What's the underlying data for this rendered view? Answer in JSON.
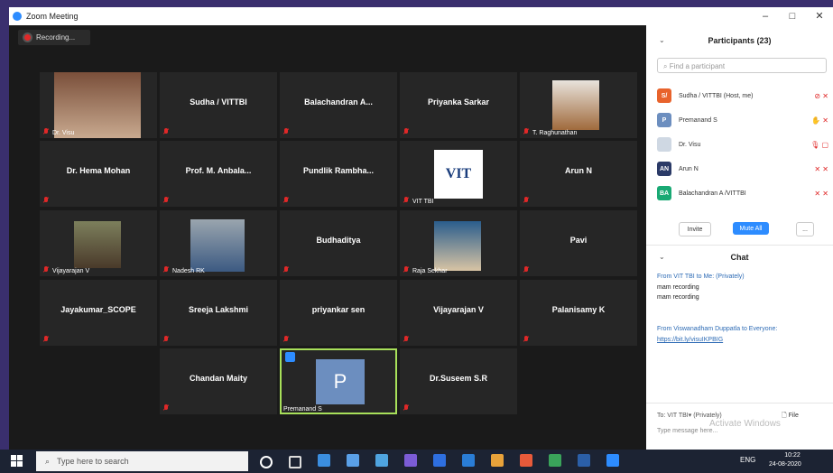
{
  "window": {
    "title": "Zoom Meeting",
    "controls": [
      "–",
      "□",
      "✕"
    ]
  },
  "recording": {
    "label": "Recording..."
  },
  "tiles": [
    {
      "name": "",
      "label": "Dr. Visu"
    },
    {
      "name": "Sudha / VITTBI",
      "label": ""
    },
    {
      "name": "Balachandran A...",
      "label": ""
    },
    {
      "name": "Priyanka Sarkar",
      "label": ""
    },
    {
      "name": "",
      "label": "T. Raghunathan"
    },
    {
      "name": "Dr. Hema Mohan",
      "label": ""
    },
    {
      "name": "Prof. M. Anbala...",
      "label": ""
    },
    {
      "name": "Pundlik Rambha...",
      "label": ""
    },
    {
      "name": "",
      "label": "VIT TBI"
    },
    {
      "name": "Arun N",
      "label": ""
    },
    {
      "name": "",
      "label": "Vijayarajan V"
    },
    {
      "name": "",
      "label": "Nadesh RK"
    },
    {
      "name": "Budhaditya",
      "label": ""
    },
    {
      "name": "",
      "label": "Raja Sekhar"
    },
    {
      "name": "Pavi",
      "label": ""
    },
    {
      "name": "Jayakumar_SCOPE",
      "label": ""
    },
    {
      "name": "Sreeja Lakshmi",
      "label": ""
    },
    {
      "name": "priyankar sen",
      "label": ""
    },
    {
      "name": "Vijayarajan V",
      "label": ""
    },
    {
      "name": "Palanisamy K",
      "label": ""
    },
    {
      "name": "Chandan Maity",
      "label": ""
    },
    {
      "name": "",
      "label": "Premanand S"
    },
    {
      "name": "Dr.Suseem S.R",
      "label": ""
    }
  ],
  "vit_logo": "VIT",
  "avatar_letter": "P",
  "participants": {
    "title": "Participants (23)",
    "search_placeholder": "Find a participant",
    "list": [
      {
        "initials": "S/",
        "name": "Sudha / VITTBI (Host, me)",
        "color": "#e8632c"
      },
      {
        "initials": "P",
        "name": "Premanand S",
        "color": "#6c8ebf"
      },
      {
        "initials": "",
        "name": "Dr. Visu",
        "color": "#cfd8e3"
      },
      {
        "initials": "AN",
        "name": "Arun N",
        "color": "#2b3a67"
      },
      {
        "initials": "BA",
        "name": "Balachandran A /VITTBI",
        "color": "#19a974"
      }
    ],
    "invite": "Invite",
    "mute_all": "Mute All",
    "more": "..."
  },
  "chat": {
    "title": "Chat",
    "msg1_from": "From VIT TBI to Me: (Privately)",
    "msg1_lines": [
      "mam recording",
      "mam recording"
    ],
    "msg2_from": "From Viswanadham Duppatla to Everyone:",
    "msg2_link": "https://bit.ly/visuIKPBIG",
    "to_label": "To: VIT TBI▾ (Privately)",
    "file": "File",
    "input_placeholder": "Type message here..."
  },
  "taskbar": {
    "search": "Type here to search",
    "lang": "ENG",
    "time": "10:22",
    "date": "24-08-2020"
  },
  "watermark": "Activate Windows"
}
